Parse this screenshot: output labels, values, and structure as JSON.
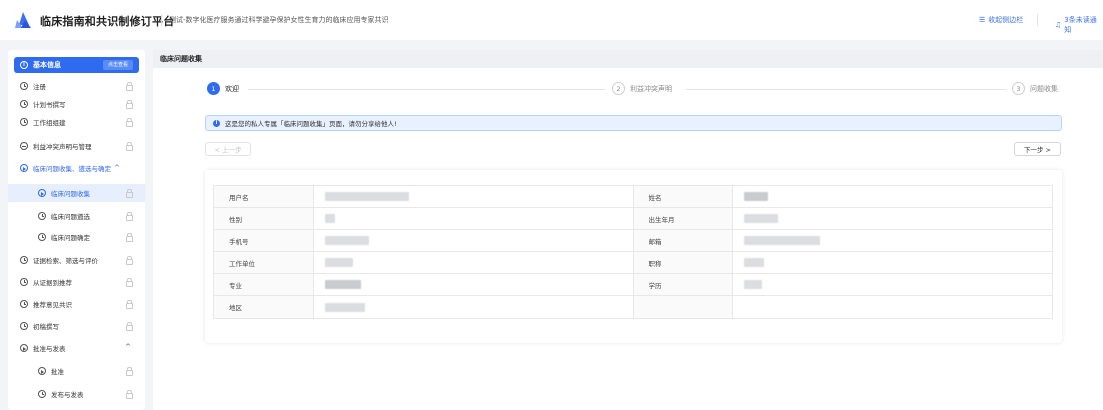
{
  "header": {
    "app_title": "临床指南和共识制修订平台",
    "project_title": "测试-数字化医疗服务通过科学避孕保护女性生育力的临床应用专家共识",
    "collapse_label": "收起侧边栏",
    "notice_label": "3条未读通知"
  },
  "sidebar": {
    "head_label": "基本信息",
    "head_tag": "点击查看",
    "items": [
      {
        "label": "注册"
      },
      {
        "label": "计划书撰写"
      },
      {
        "label": "工作组组建"
      },
      {
        "label": "利益冲突声明与管理"
      },
      {
        "label": "临床问题收集、遴选与确定"
      },
      {
        "label": "临床问题收集"
      },
      {
        "label": "临床问题遴选"
      },
      {
        "label": "临床问题确定"
      },
      {
        "label": "证据检索、筛选与评价"
      },
      {
        "label": "从证据到推荐"
      },
      {
        "label": "推荐意见共识"
      },
      {
        "label": "初稿撰写"
      },
      {
        "label": "批准与发表"
      },
      {
        "label": "批准"
      },
      {
        "label": "发布与发表"
      }
    ]
  },
  "main": {
    "tab_label": "临床问题收集",
    "steps": [
      {
        "num": "1",
        "label": "欢迎"
      },
      {
        "num": "2",
        "label": "利益冲突声明"
      },
      {
        "num": "3",
        "label": "问题收集"
      }
    ],
    "notice": "这是您的私人专属「临床问题收集」页面，请勿分享给他人!",
    "prev_label": "< 上一步",
    "next_label": "下一步 >",
    "fields": [
      [
        "用户名",
        "姓名"
      ],
      [
        "性别",
        "出生年月"
      ],
      [
        "手机号",
        "邮箱"
      ],
      [
        "工作单位",
        "职称"
      ],
      [
        "专业",
        "学历"
      ],
      [
        "地区",
        ""
      ]
    ]
  },
  "colors": {
    "accent": "#2f6bf0",
    "notice_bg": "#e8f1ff"
  }
}
